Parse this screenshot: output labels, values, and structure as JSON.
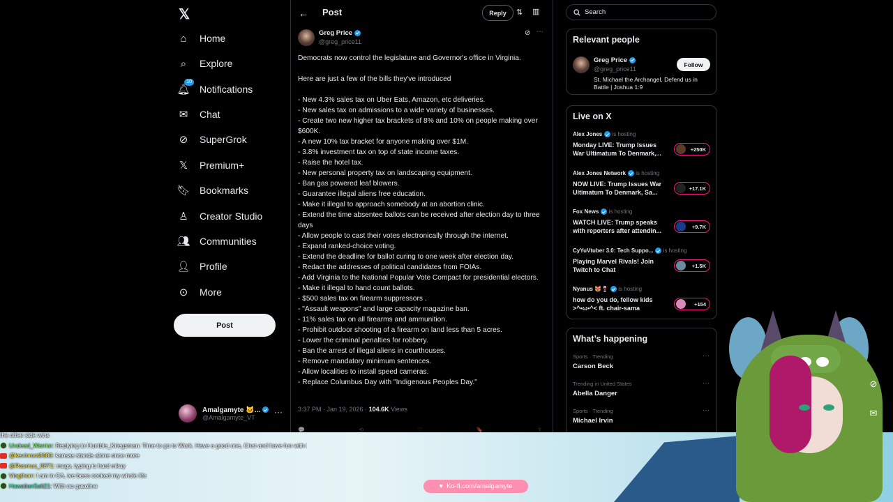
{
  "nav": {
    "items": [
      {
        "label": "Home",
        "icon": "home-icon"
      },
      {
        "label": "Explore",
        "icon": "search-icon"
      },
      {
        "label": "Notifications",
        "icon": "bell-icon",
        "badge": "10"
      },
      {
        "label": "Chat",
        "icon": "chat-icon"
      },
      {
        "label": "SuperGrok",
        "icon": "grok-icon"
      },
      {
        "label": "Premium+",
        "icon": "x-icon"
      },
      {
        "label": "Bookmarks",
        "icon": "bookmark-icon"
      },
      {
        "label": "Creator Studio",
        "icon": "creator-icon"
      },
      {
        "label": "Communities",
        "icon": "communities-icon"
      },
      {
        "label": "Profile",
        "icon": "profile-icon"
      },
      {
        "label": "More",
        "icon": "more-icon"
      }
    ],
    "post_label": "Post",
    "account": {
      "name": "Amalgamyte 🐱...",
      "handle": "@Amalgamyte_VT"
    }
  },
  "post": {
    "header_title": "Post",
    "reply_label": "Reply",
    "author_name": "Greg Price",
    "author_handle": "@greg_price11",
    "body": "Democrats now control the legislature and Governor's office in Virginia.\n\nHere are just a few of the bills they've introduced\n\n- New 4.3% sales tax on Uber Eats, Amazon, etc deliveries.\n- New sales tax on admissions to a wide variety of businesses.\n- Create two new higher tax brackets of 8% and 10% on people making over $600K.\n- A new 10% tax bracket for anyone making over $1M.\n- 3.8% investment tax on top of state income taxes.\n- Raise the hotel tax.\n- New personal property tax on landscaping equipment.\n- Ban gas powered leaf blowers.\n- Guarantee illegal aliens free education.\n- Make it illegal to approach somebody at an abortion clinic.\n- Extend the time absentee ballots can be received after election day to three days\n- Allow people to cast their votes electronically through the internet.\n- Expand ranked-choice voting.\n- Extend the deadline for ballot curing to one week after election day.\n- Redact the addresses of political candidates from FOIAs.\n- Add Virginia to the National Popular Vote Compact for presidential electors.\n- Make it illegal to hand count ballots.\n- $500 sales tax on firearm suppressors .\n- \"Assault weapons\" and large capacity magazine ban.\n- 11% sales tax on all firearms and ammunition.\n- Prohibit outdoor shooting of a firearm on land less than 5 acres.\n- Lower the criminal penalties for robbery.\n- Ban the arrest of illegal aliens in courthouses.\n- Remove mandatory minimum sentences.\n- Allow localities to install speed cameras.\n- Replace Columbus Day with \"Indigenous Peoples Day.\"",
    "time": "3:37 PM · Jan 19, 2026 · ",
    "views_count": "104.6K",
    "views_label": " Views"
  },
  "sidebar": {
    "search_placeholder": "Search",
    "relevant": {
      "title": "Relevant people",
      "name": "Greg Price",
      "handle": "@greg_price11",
      "bio": "St. Michael the Archangel, Defend us in Battle | Joshua 1:9",
      "follow_label": "Follow"
    },
    "live": {
      "title": "Live on X",
      "hosting_label": "is hosting",
      "items": [
        {
          "host": "Alex Jones",
          "title": "Monday LIVE: Trump Issues War Ultimatum To Denmark,...",
          "count": "+250K"
        },
        {
          "host": "Alex Jones Network",
          "title": "NOW LIVE: Trump Issues War Ultimatum To Denmark, Sa...",
          "count": "+17.1K"
        },
        {
          "host": "Fox News",
          "title": "WATCH LIVE: Trump speaks with reporters after attendin...",
          "count": "+9.7K"
        },
        {
          "host": "CyYuVtuber 3.0: Tech Suppo...",
          "title": "Playing Marvel Rivals! Join Twitch to Chat",
          "count": "+1.5K"
        },
        {
          "host": "Nyanus 😻🍷",
          "title": "how do you do, fellow kids >^•ω•^< ft. chair-sama",
          "count": "+154"
        }
      ]
    },
    "trending": {
      "title": "What’s happening",
      "items": [
        {
          "category": "Sports · Trending",
          "name": "Carson Beck"
        },
        {
          "category": "Trending in United States",
          "name": "Abella Danger"
        },
        {
          "category": "Sports · Trending",
          "name": "Michael Irvin"
        }
      ]
    }
  },
  "stream": {
    "chat": [
      {
        "name": "",
        "text": "the other side wins"
      },
      {
        "name": "Undead_Warrior:",
        "text": " Replying to Humble_Kriegsman: Time to go to Work. Have a good one, Chat and have fun with the Stream. The Emperor protects! goodbye Deus Imperator Vult"
      },
      {
        "name": "@kevinroot8680:",
        "text": " kansas stands alone once more"
      },
      {
        "name": "@Rasmus_0871:",
        "text": " mags, typing is hard mkay"
      },
      {
        "name": "Vingthorr:",
        "text": " I am in CA, ive been cooked my whole life"
      },
      {
        "name": "HawaiianSalt21:",
        "text": " With no gasoline"
      }
    ],
    "kofi_label": "Ko-fi.com/amalgamyte"
  }
}
